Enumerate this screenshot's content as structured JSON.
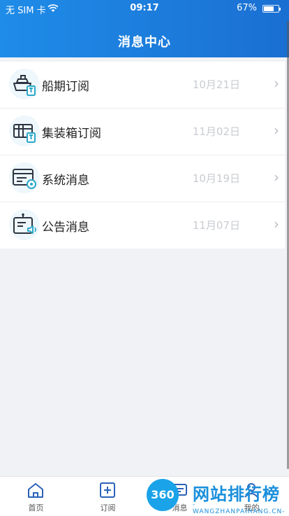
{
  "status_bar": {
    "carrier": "无 SIM 卡",
    "time": "09:17",
    "battery": "67%"
  },
  "header": {
    "title": "消息中心"
  },
  "messages": [
    {
      "label": "船期订阅",
      "date": "10月21日",
      "icon": "ship-subscription-icon"
    },
    {
      "label": "集装箱订阅",
      "date": "11月02日",
      "icon": "container-subscription-icon"
    },
    {
      "label": "系统消息",
      "date": "10月19日",
      "icon": "system-message-icon"
    },
    {
      "label": "公告消息",
      "date": "11月07日",
      "icon": "announcement-icon"
    }
  ],
  "tabbar": {
    "tabs": [
      {
        "label": "首页",
        "icon": "home-icon"
      },
      {
        "label": "订阅",
        "icon": "add-subscription-icon"
      },
      {
        "label": "消息",
        "icon": "message-icon"
      },
      {
        "label": "我的",
        "icon": "profile-icon"
      }
    ]
  },
  "watermark": {
    "logo": "360",
    "text": "网站排行榜",
    "sub": "-WANGZHANPAIHANG.CN-"
  },
  "colors": {
    "accent": "#1a6fd2",
    "icon_teal": "#2aa7c9",
    "icon_dark": "#2b3440"
  }
}
